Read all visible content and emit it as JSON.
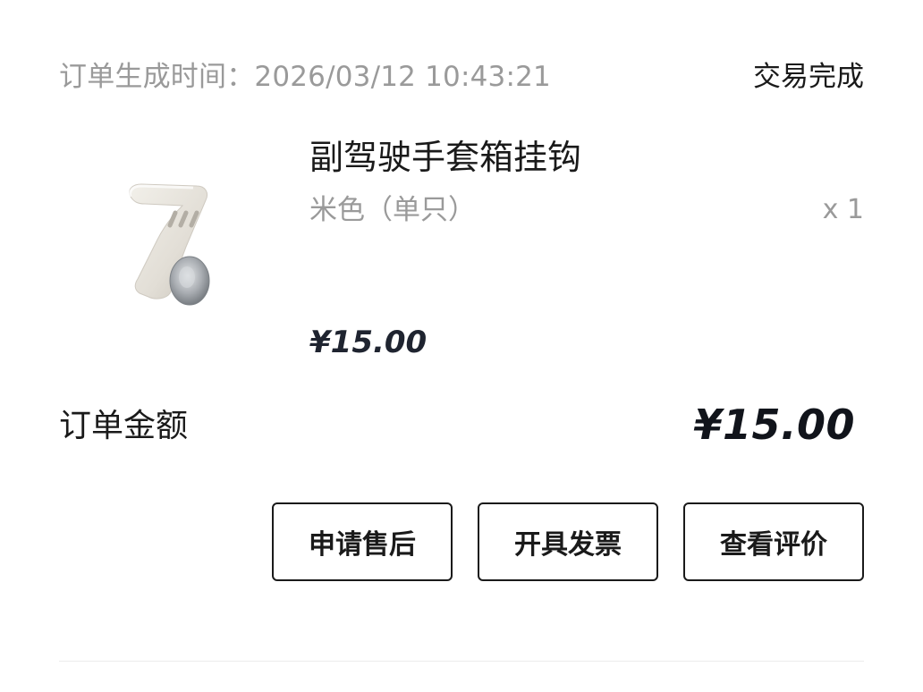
{
  "order": {
    "created_time": "订单生成时间：2026/03/12 10:43:21",
    "status": "交易完成"
  },
  "product": {
    "title": "副驾驶手套箱挂钩",
    "spec": "米色（单只）",
    "quantity": "x 1",
    "price": "¥15.00",
    "image_icon": "beige-hook-product-image"
  },
  "summary": {
    "amount_label": "订单金额",
    "amount_value": "¥15.00"
  },
  "actions": {
    "after_sales": "申请售后",
    "invoice": "开具发票",
    "view_review": "查看评价"
  },
  "colors": {
    "primary_text": "#1a1a1a",
    "secondary_text": "#9a9a9a",
    "price_text": "#1f2430",
    "divider": "#ececec"
  }
}
